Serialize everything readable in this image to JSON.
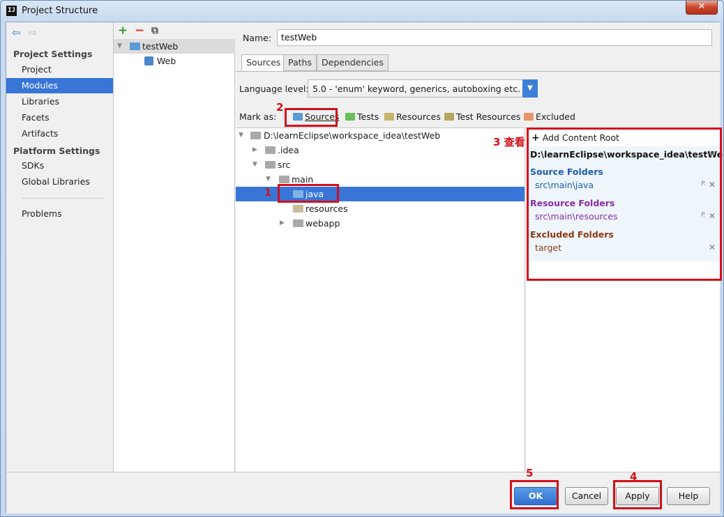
{
  "window": {
    "title": "Project Structure",
    "app_icon": "IJ",
    "close": "✕"
  },
  "nav": {
    "back_icon": "back-arrow-icon",
    "forward_icon": "forward-arrow-icon",
    "project_settings": "Project Settings",
    "items_ps": [
      "Project",
      "Modules",
      "Libraries",
      "Facets",
      "Artifacts"
    ],
    "platform_settings": "Platform Settings",
    "items_pl": [
      "SDKs",
      "Global Libraries"
    ],
    "problems": "Problems",
    "selected": "Modules"
  },
  "modules": {
    "toolbar": {
      "add": "+",
      "remove": "−",
      "copy": "⧉"
    },
    "tree": [
      {
        "label": "testWeb"
      },
      {
        "label": "Web"
      }
    ]
  },
  "main": {
    "name_label": "Name:",
    "name_value": "testWeb",
    "tabs": [
      "Sources",
      "Paths",
      "Dependencies"
    ],
    "selected_tab": "Sources",
    "lang_label": "Language level:",
    "lang_value": "5.0 - 'enum' keyword, generics, autoboxing etc.",
    "mark_as_label": "Mark as:",
    "mark_as": [
      {
        "label": "Sources",
        "color": "#5b9bd5"
      },
      {
        "label": "Tests",
        "color": "#6bbf59"
      },
      {
        "label": "Resources",
        "color": "#c8b56a"
      },
      {
        "label": "Test Resources",
        "color": "#c8b56a"
      },
      {
        "label": "Excluded",
        "color": "#e8956a"
      }
    ],
    "content_tree": [
      {
        "label": "D:\\learnEclipse\\workspace_idea\\testWeb"
      },
      {
        "label": ".idea"
      },
      {
        "label": "src"
      },
      {
        "label": "main"
      },
      {
        "label": "java"
      },
      {
        "label": "resources"
      },
      {
        "label": "webapp"
      }
    ]
  },
  "roots": {
    "add_content_root": "Add Content Root",
    "root_path": "D:\\learnEclipse\\workspace_idea\\testWeb",
    "source_folders_title": "Source Folders",
    "source_folder": "src\\main\\java",
    "resource_folders_title": "Resource Folders",
    "resource_folder": "src\\main\\resources",
    "excluded_folders_title": "Excluded Folders",
    "excluded_folder": "target",
    "colors": {
      "source": "#1d5ea8",
      "resource": "#8a2ea3",
      "excluded": "#8b3a14"
    }
  },
  "buttons": {
    "ok": "OK",
    "cancel": "Cancel",
    "apply": "Apply",
    "help": "Help"
  },
  "annotations": {
    "n1": "1",
    "n2": "2",
    "n3": "3 查看",
    "n4": "4",
    "n5": "5"
  }
}
